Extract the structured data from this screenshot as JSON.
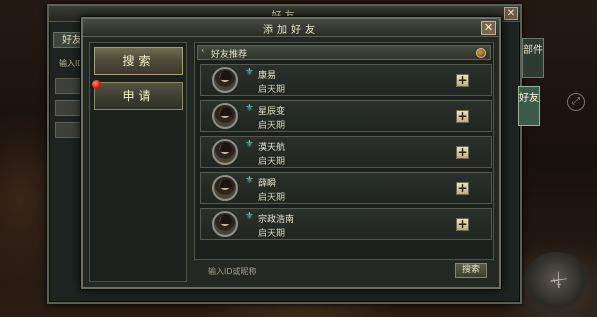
{
  "background_panel": {
    "title": "好友",
    "tab_label": "好友",
    "search_placeholder": "输入ID",
    "close_glyph": "✕"
  },
  "side_tabs": [
    {
      "label": "部件",
      "active": false
    },
    {
      "label": "好友",
      "active": true
    }
  ],
  "dialog": {
    "title": "添加好友",
    "close_glyph": "✕",
    "menu": [
      {
        "label": "搜索",
        "has_notification": false
      },
      {
        "label": "申请",
        "has_notification": true
      }
    ],
    "section_title": "好友推荐",
    "section_arrow": "‹",
    "add_glyph": "+",
    "friends": [
      {
        "name": "康易",
        "rank": "启天期"
      },
      {
        "name": "星辰变",
        "rank": "启天期"
      },
      {
        "name": "漠天航",
        "rank": "启天期"
      },
      {
        "name": "薛瞬",
        "rank": "启天期"
      },
      {
        "name": "宗政浩南",
        "rank": "启天期"
      }
    ],
    "search": {
      "placeholder": "输入ID或昵称",
      "button_label": "搜索"
    }
  },
  "colors": {
    "panel_bg": "#232823",
    "button_gold": "#6e6b51",
    "occupation_icon": "#5ec7c6",
    "notification_red": "#d4170f"
  }
}
